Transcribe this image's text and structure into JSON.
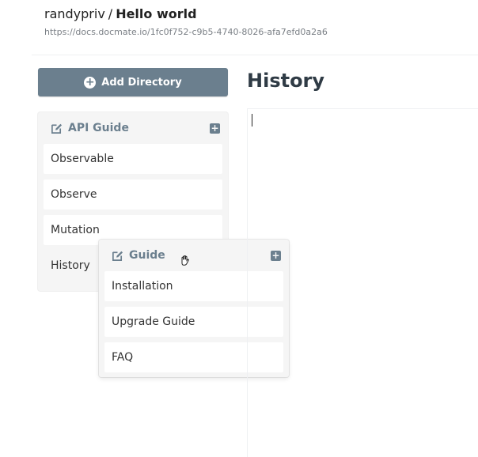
{
  "header": {
    "owner": "randypriv",
    "separator": "/",
    "doc_name": "Hello world",
    "url": "https://docs.docmate.io/1fc0f752-c9b5-4740-8026-afa7efd0a2a6"
  },
  "sidebar": {
    "add_directory_label": "Add Directory",
    "directories": [
      {
        "title": "API Guide",
        "pages": [
          "Observable",
          "Observe",
          "Mutation",
          "History"
        ]
      },
      {
        "title": "Guide",
        "pages": [
          "Installation",
          "Upgrade Guide",
          "FAQ"
        ]
      }
    ]
  },
  "editor": {
    "title": "History"
  },
  "colors": {
    "button_bg": "#6b7f8e",
    "panel_bg": "#f5f5f5",
    "text_dark": "#2f3b45"
  },
  "icons": {
    "add_directory": "plus-circle-icon",
    "edit_directory": "edit-icon",
    "add_page": "plus-square-icon",
    "drag": "grab-hand-icon"
  }
}
